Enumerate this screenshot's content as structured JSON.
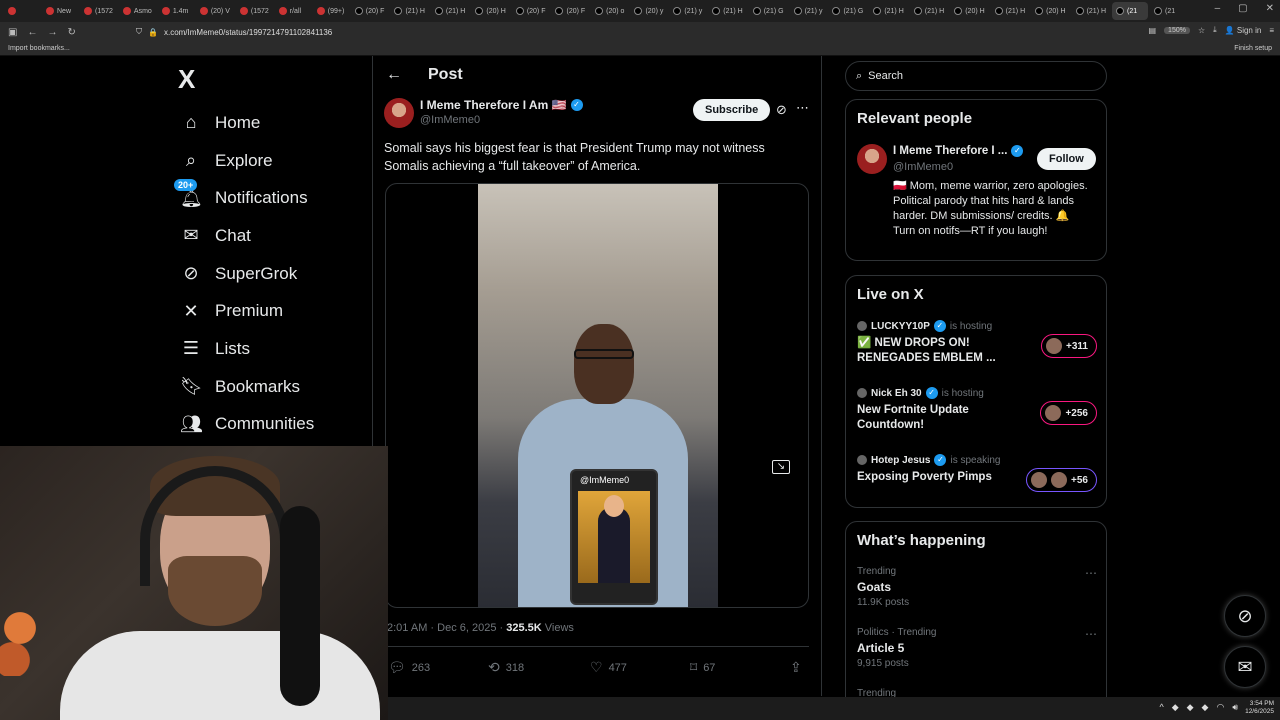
{
  "browser": {
    "tabs": [
      {
        "label": ""
      },
      {
        "label": "New"
      },
      {
        "label": "(1572"
      },
      {
        "label": "Asmo"
      },
      {
        "label": "1.4m"
      },
      {
        "label": "(20) V"
      },
      {
        "label": "(1572"
      },
      {
        "label": "r/all"
      },
      {
        "label": "(99+)"
      },
      {
        "label": "(20) F"
      },
      {
        "label": "(21) H"
      },
      {
        "label": "(21) H"
      },
      {
        "label": "(20) H"
      },
      {
        "label": "(20) F"
      },
      {
        "label": "(20) F"
      },
      {
        "label": "(20) o"
      },
      {
        "label": "(20) y"
      },
      {
        "label": "(21) y"
      },
      {
        "label": "(21) H"
      },
      {
        "label": "(21) G"
      },
      {
        "label": "(21) y"
      },
      {
        "label": "(21) G"
      },
      {
        "label": "(21) H"
      },
      {
        "label": "(21) H"
      },
      {
        "label": "(20) H"
      },
      {
        "label": "(21) H"
      },
      {
        "label": "(20) H"
      },
      {
        "label": "(21) H"
      },
      {
        "label": "(21"
      },
      {
        "label": "(21"
      }
    ],
    "url": "x.com/ImMeme0/status/1997214791102841136",
    "zoom": "150%",
    "sign_in": "Sign in",
    "import_bookmarks": "Import bookmarks...",
    "finish_setup": "Finish setup"
  },
  "sidebar": {
    "logo": "X",
    "items": [
      {
        "icon": "home-icon",
        "label": "Home"
      },
      {
        "icon": "search-icon",
        "label": "Explore"
      },
      {
        "icon": "bell-icon",
        "label": "Notifications",
        "badge": "20+"
      },
      {
        "icon": "mail-icon",
        "label": "Chat"
      },
      {
        "icon": "grok-icon",
        "label": "SuperGrok"
      },
      {
        "icon": "x-icon",
        "label": "Premium"
      },
      {
        "icon": "list-icon",
        "label": "Lists"
      },
      {
        "icon": "bookmark-icon",
        "label": "Bookmarks"
      },
      {
        "icon": "communities-icon",
        "label": "Communities"
      }
    ]
  },
  "post": {
    "header_title": "Post",
    "author_name": "I Meme Therefore I Am 🇺🇸",
    "author_handle": "@ImMeme0",
    "subscribe_label": "Subscribe",
    "text": "Somali says his biggest fear is that President Trump may not witness Somalis achieving a “full takeover” of America.",
    "video_watermark": "@ImMeme0",
    "time": "2:01 AM · Dec 6, 2025 · ",
    "views": "325.5K",
    "views_label": " Views",
    "replies": "263",
    "reposts": "318",
    "likes": "477",
    "bookmarks": "67"
  },
  "right": {
    "search_placeholder": "Search",
    "relevant_title": "Relevant people",
    "rp_name": "I Meme Therefore I ...",
    "rp_handle": "@ImMeme0",
    "follow_label": "Follow",
    "rp_bio": "🇵🇱 Mom, meme warrior, zero apologies. Political parody that hits hard & lands harder. DM submissions/ credits. 🔔 Turn on notifs—RT if you laugh!",
    "live_title": "Live on X",
    "live": [
      {
        "host": "LUCKYY10P",
        "status": "is hosting",
        "title": "✅ NEW DROPS ON! RENEGADES EMBLEM ...",
        "count": "+311"
      },
      {
        "host": "Nick Eh 30",
        "status": "is hosting",
        "title": "New Fortnite Update Countdown!",
        "count": "+256"
      },
      {
        "host": "Hotep Jesus",
        "status": "is speaking",
        "title": "Exposing Poverty Pimps",
        "count": "+56"
      }
    ],
    "happening_title": "What’s happening",
    "trends": [
      {
        "category": "Trending",
        "title": "Goats",
        "posts": "11.9K posts"
      },
      {
        "category": "Politics · Trending",
        "title": "Article 5",
        "posts": "9,915 posts"
      },
      {
        "category": "Trending",
        "title": "",
        "posts": ""
      }
    ]
  },
  "taskbar": {
    "time": "3:54 PM",
    "date": "12/6/2025"
  }
}
